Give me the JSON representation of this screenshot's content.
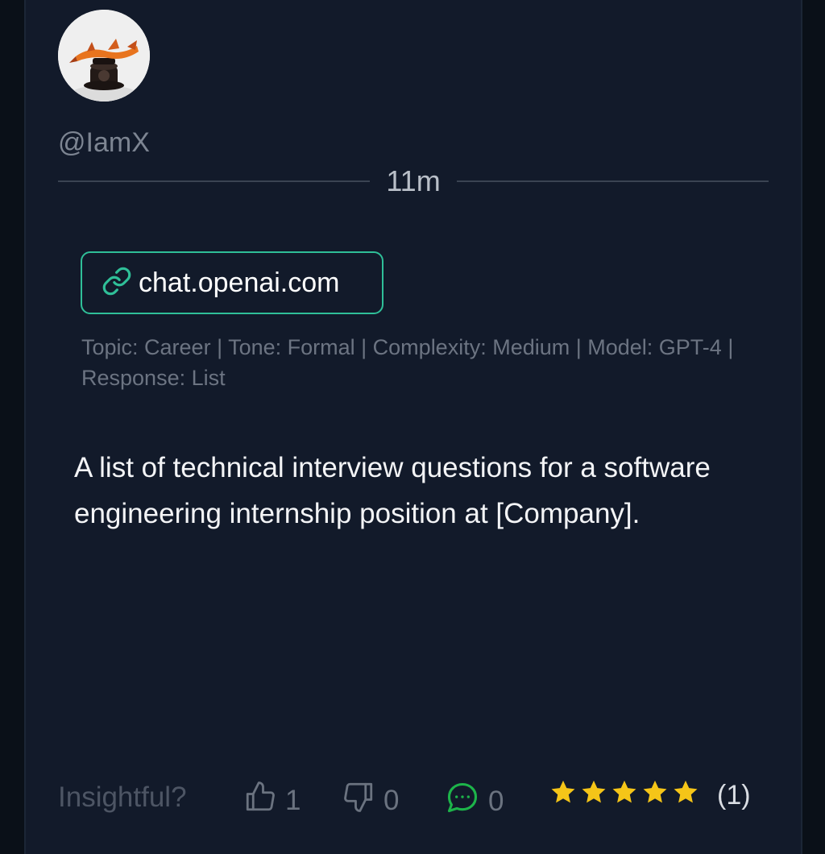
{
  "post": {
    "username": "@IamX",
    "time_ago": "11m",
    "link": {
      "icon": "link-icon",
      "text": "chat.openai.com"
    },
    "meta": "Topic: Career | Tone: Formal | Complexity: Medium | Model: GPT-4 | Response: List",
    "prompt": "A list of technical interview questions for a software engineering internship position at [Company]."
  },
  "footer": {
    "insightful_label": "Insightful?",
    "likes": "1",
    "dislikes": "0",
    "comments": "0",
    "stars": 5,
    "rating_count": "(1)"
  },
  "colors": {
    "accent": "#2fbf98",
    "star": "#f5c518",
    "comment": "#1db44a",
    "background": "#121a2a"
  }
}
